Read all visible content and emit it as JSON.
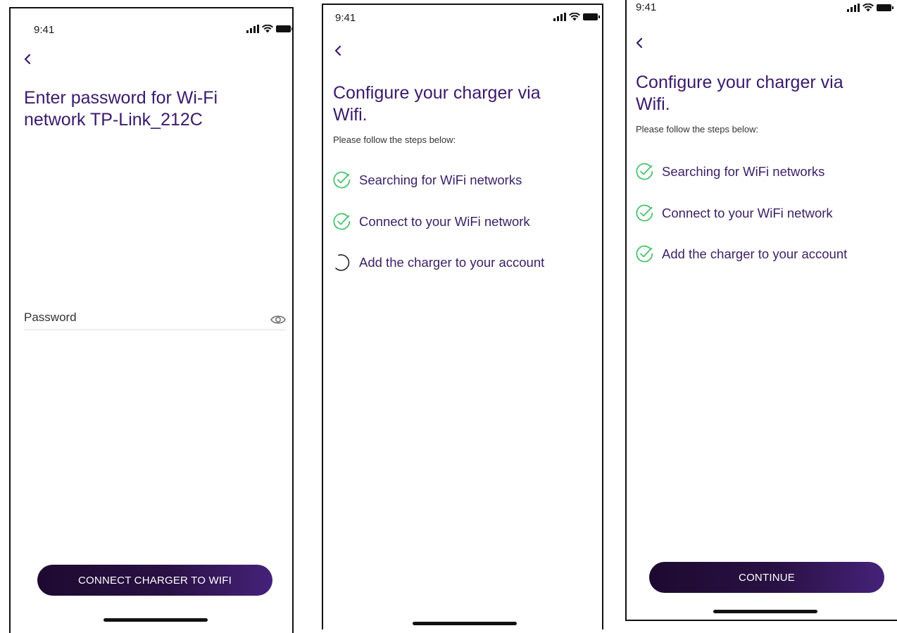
{
  "colors": {
    "title": "#3a1a6b",
    "check": "#4cc36f",
    "button_start": "#1d0a30",
    "button_end": "#45227a"
  },
  "screen1": {
    "time": "9:41",
    "back_icon": "chevron-left-icon",
    "title": "Enter password for Wi-Fi\nnetwork TP-Link_212C",
    "password_label": "Password",
    "eye_icon": "eye-icon",
    "button_label": "CONNECT CHARGER TO WIFI"
  },
  "screen2": {
    "time": "9:41",
    "back_icon": "chevron-left-icon",
    "title": "Configure your charger via\nWifi.",
    "subtitle": "Please follow the steps below:",
    "steps": [
      {
        "label": "Searching for WiFi networks",
        "status": "done"
      },
      {
        "label": "Connect to your WiFi network",
        "status": "done"
      },
      {
        "label": "Add the charger to your account",
        "status": "loading"
      }
    ]
  },
  "screen3": {
    "time": "9:41",
    "back_icon": "chevron-left-icon",
    "title": "Configure your charger via\nWifi.",
    "subtitle": "Please follow the steps below:",
    "steps": [
      {
        "label": "Searching for WiFi networks",
        "status": "done"
      },
      {
        "label": "Connect to your WiFi network",
        "status": "done"
      },
      {
        "label": "Add the charger to your account",
        "status": "done"
      }
    ],
    "button_label": "CONTINUE"
  }
}
